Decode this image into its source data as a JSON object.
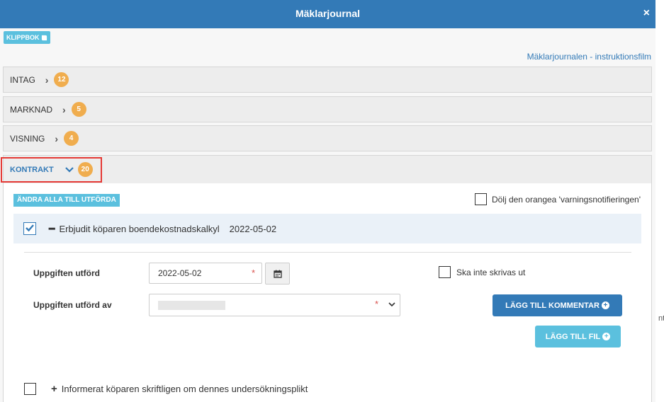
{
  "dialog": {
    "title": "Mäklarjournal",
    "close_glyph": "×"
  },
  "toolbar": {
    "klippbok_label": "KLIPPBOK",
    "instruction_link": "Mäklarjournalen - instruktionsfilm"
  },
  "sections": [
    {
      "label": "INTAG",
      "count": "12",
      "expanded": false
    },
    {
      "label": "MARKNAD",
      "count": "5",
      "expanded": false
    },
    {
      "label": "VISNING",
      "count": "4",
      "expanded": false
    },
    {
      "label": "KONTRAKT",
      "count": "20",
      "expanded": true
    }
  ],
  "kontrakt": {
    "mark_all_label": "ÄNDRA ALLA TILL UTFÖRDA",
    "hide_warning_label": "Dölj den orangea 'varningsnotifieringen'",
    "task1": {
      "title": "Erbjudit köparen boendekostnadskalkyl",
      "date": "2022-05-02",
      "checked": true,
      "completed_label": "Uppgiften utförd",
      "completed_date": "2022-05-02",
      "completed_by_label": "Uppgiften utförd av",
      "no_print_label": "Ska inte skrivas ut",
      "add_comment_label": "LÄGG TILL KOMMENTAR",
      "add_file_label": "LÄGG TILL FIL"
    },
    "task2": {
      "title": "Informerat köparen skriftligen om dennes undersökningsplikt",
      "checked": false
    }
  },
  "background": {
    "fragment": "nt"
  },
  "colors": {
    "primary": "#337ab7",
    "info": "#5bc0de",
    "badge": "#f0ad4e",
    "required": "#d9534f",
    "highlight": "#e53935"
  },
  "icons": [
    "close-icon",
    "book-icon",
    "chevron-right-icon",
    "chevron-down-icon",
    "calendar-icon",
    "caret-down-icon",
    "plus-circle-icon",
    "minus-icon",
    "plus-icon",
    "check-icon"
  ]
}
